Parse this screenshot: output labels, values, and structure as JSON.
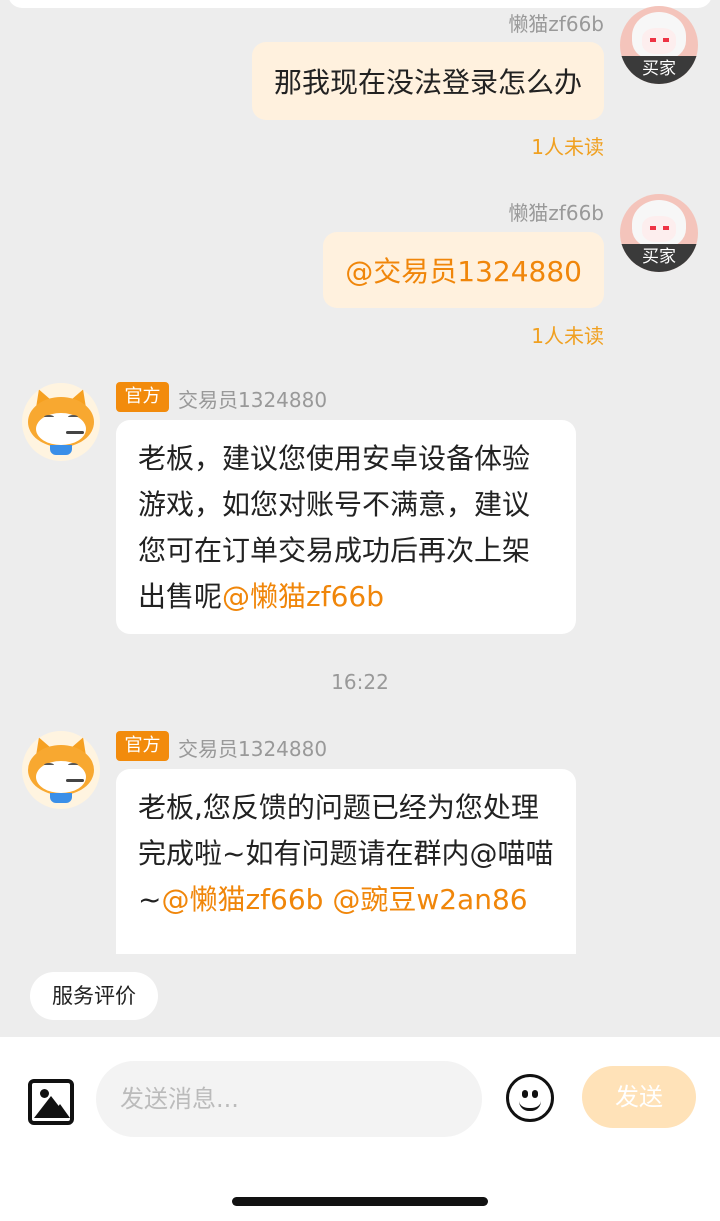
{
  "messages": [
    {
      "side": "right",
      "sender": "懒猫zf66b",
      "badge": "买家",
      "text": "那我现在没法登录怎么办",
      "status": "1人未读"
    },
    {
      "side": "right",
      "sender": "懒猫zf66b",
      "badge": "买家",
      "text": "@交易员1324880",
      "status": "1人未读"
    },
    {
      "side": "left",
      "tag": "官方",
      "sender": "交易员1324880",
      "text": "老板，建议您使用安卓设备体验游戏，如您对账号不满意，建议您可在订单交易成功后再次上架出售呢",
      "mention": "@懒猫zf66b"
    },
    {
      "side": "left",
      "tag": "官方",
      "sender": "交易员1324880",
      "text": "老板,您反馈的问题已经为您处理完成啦~如有问题请在群内@喵喵~",
      "mention": "@懒猫zf66b @豌豆w2an86"
    }
  ],
  "timestamp": "16:22",
  "review_chip": "服务评价",
  "composer": {
    "placeholder": "发送消息...",
    "send_label": "发送"
  },
  "icons": [
    "image-icon",
    "emoji-icon"
  ],
  "colors": {
    "accent": "#f0860a",
    "unread": "#f0a020",
    "right_bubble": "#fff1de",
    "send_disabled": "#ffe2b8"
  }
}
